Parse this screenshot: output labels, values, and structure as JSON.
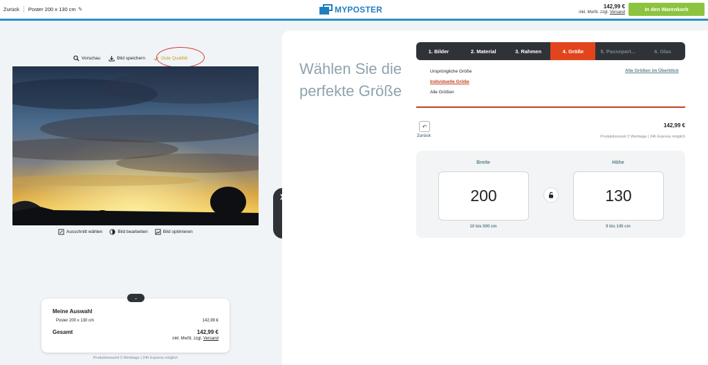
{
  "header": {
    "back_label": "Zurück",
    "product_label": "Poster 200 x 130 cm",
    "logo_text": "MYPOSTER",
    "price": "142,99 €",
    "vat_prefix": "inkl. MwSt. zzgl.",
    "shipping_link": "Versand",
    "cart_button": "In den Warenkorb",
    "accent_color": "#8dc43f",
    "brand_color": "#1f7fbf"
  },
  "image_tools": {
    "preview": "Vorschau",
    "save": "Bild speichern",
    "quality": "Gute Qualität",
    "crop": "Ausschnitt wählen",
    "edit": "Bild bearbeiten",
    "optimize": "Bild optimieren"
  },
  "collapse_tab": {
    "label": "Schließen"
  },
  "summary": {
    "title": "Meine Auswahl",
    "item_label": "Poster 200 x 130 cm",
    "item_price": "142,99 €",
    "total_label": "Gesamt",
    "total_price": "142,99 €",
    "vat_prefix": "inkl. MwSt. zzgl.",
    "shipping_link": "Versand",
    "production_time": "Produktionszeit 2 Werktage | 24h Express möglich"
  },
  "panel": {
    "headline": "Wählen Sie die perfekte Größe",
    "steps": [
      {
        "label": "1. Bilder"
      },
      {
        "label": "2. Material"
      },
      {
        "label": "3. Rahmen"
      },
      {
        "label": "4. Größe"
      },
      {
        "label": "5. Passepart..."
      },
      {
        "label": "6. Glas"
      }
    ],
    "active_step_color": "#e2451c",
    "size_options": {
      "original": "Ursprüngliche Größe",
      "custom": "Individuelle Größe",
      "all": "Alle Größen"
    },
    "overview_link": "Alle Größen im Überblick",
    "back_label": "Zurück",
    "price": "142,99 €",
    "production_time": "Produktionszeit 2 Werktage | 24h Express möglich",
    "width": {
      "label": "Breite",
      "value": "200",
      "range": "10 bis 500 cm"
    },
    "height": {
      "label": "Höhe",
      "value": "130",
      "range": "9 bis 145 cm"
    },
    "lock_icon": "lock-open-icon"
  }
}
